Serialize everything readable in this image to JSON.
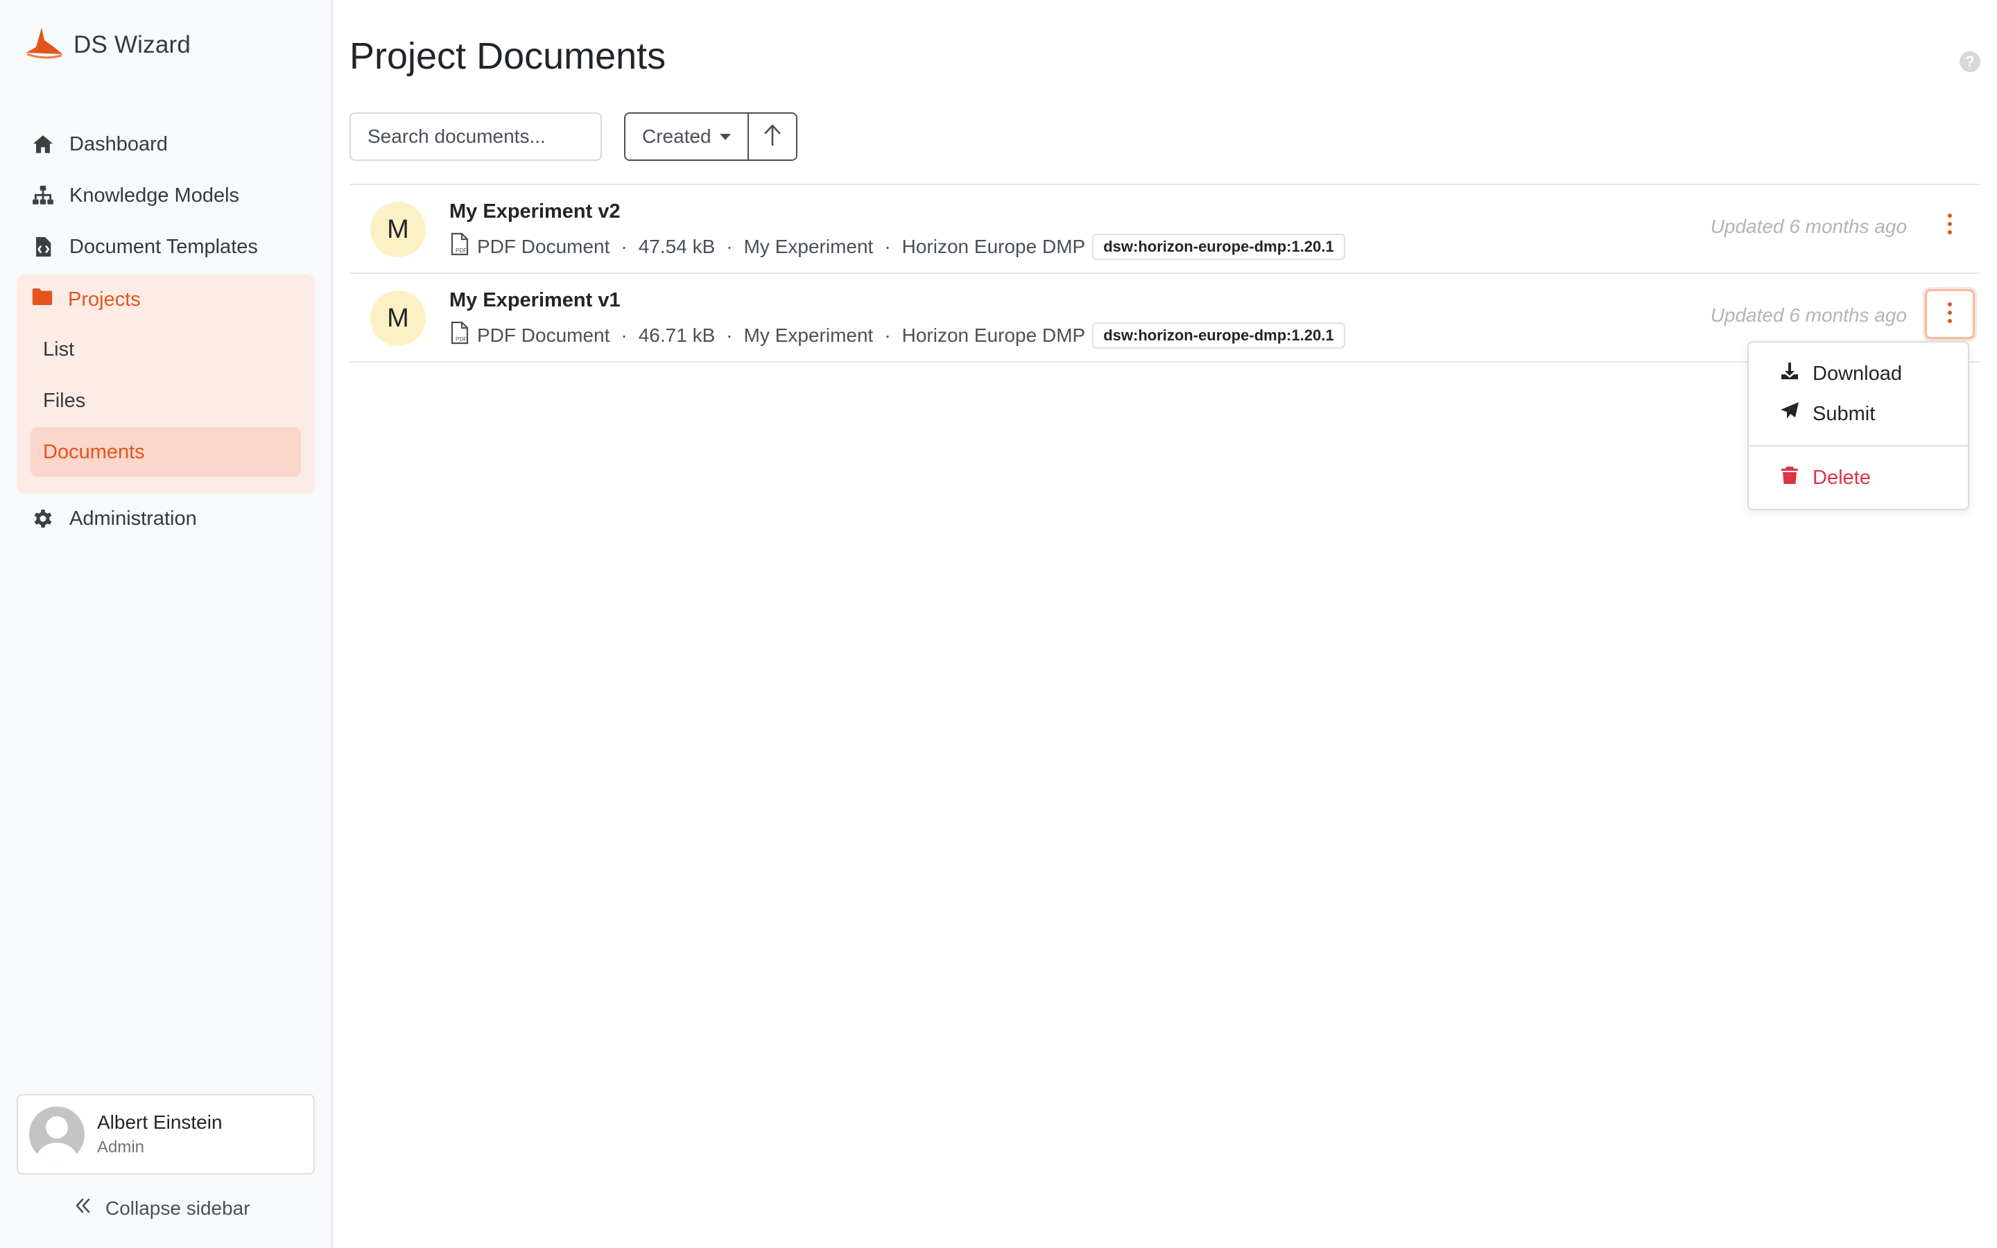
{
  "app": {
    "name": "DS Wizard",
    "brand_color": "#e2561c"
  },
  "sidebar": {
    "items": [
      {
        "label": "Dashboard",
        "icon": "home-icon"
      },
      {
        "label": "Knowledge Models",
        "icon": "sitemap-icon"
      },
      {
        "label": "Document Templates",
        "icon": "file-code-icon"
      },
      {
        "label": "Projects",
        "icon": "folder-icon",
        "active": true
      },
      {
        "label": "Administration",
        "icon": "gear-icon"
      }
    ],
    "projects_sub": [
      {
        "label": "List"
      },
      {
        "label": "Files"
      },
      {
        "label": "Documents",
        "active": true
      }
    ],
    "user": {
      "name": "Albert Einstein",
      "role": "Admin"
    },
    "collapse_label": "Collapse sidebar"
  },
  "main": {
    "title": "Project Documents",
    "search": {
      "placeholder": "Search documents...",
      "value": ""
    },
    "sort": {
      "label": "Created",
      "direction": "ascending"
    },
    "documents": [
      {
        "avatar": "M",
        "name": "My Experiment v2",
        "format": "PDF Document",
        "size": "47.54 kB",
        "project": "My Experiment",
        "template": "Horizon Europe DMP",
        "template_id": "dsw:horizon-europe-dmp:1.20.1",
        "updated": "Updated 6 months ago"
      },
      {
        "avatar": "M",
        "name": "My Experiment v1",
        "format": "PDF Document",
        "size": "46.71 kB",
        "project": "My Experiment",
        "template": "Horizon Europe DMP",
        "template_id": "dsw:horizon-europe-dmp:1.20.1",
        "updated": "Updated 6 months ago"
      }
    ],
    "separator": "·",
    "context_menu": {
      "items": [
        {
          "label": "Download",
          "icon": "download-icon"
        },
        {
          "label": "Submit",
          "icon": "paper-plane-icon"
        },
        {
          "label": "Delete",
          "icon": "trash-icon",
          "danger": true
        }
      ]
    }
  }
}
